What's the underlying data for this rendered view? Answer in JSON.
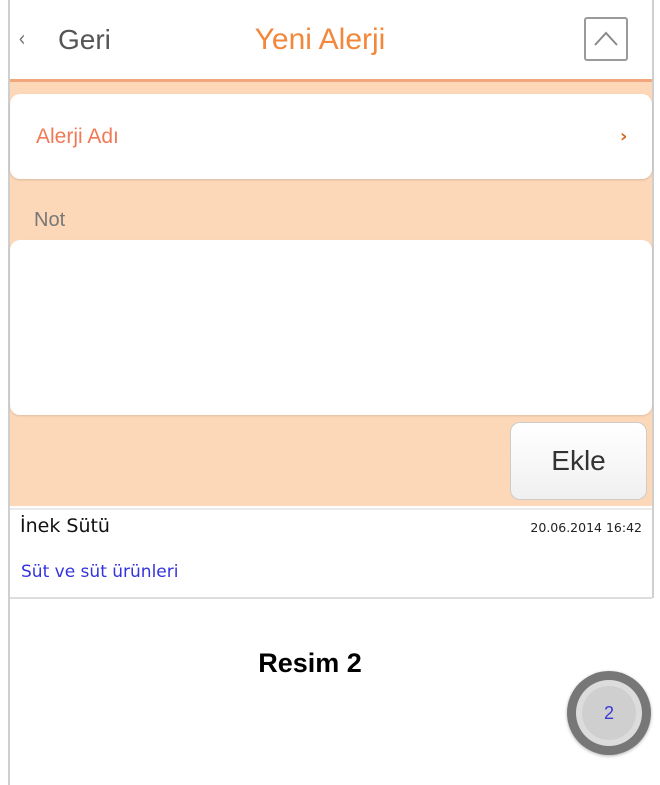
{
  "header": {
    "back_label": "Geri",
    "title": "Yeni Alerji",
    "back_icon": "chevron-left-icon",
    "collapse_icon": "chevron-up-icon"
  },
  "form": {
    "allergy_name_label": "Alerji Adı",
    "note_label": "Not",
    "note_value": "",
    "add_button_label": "Ekle"
  },
  "list": {
    "items": [
      {
        "name": "İnek Sütü",
        "date": "20.06.2014 16:42",
        "category": "Süt ve süt ürünleri"
      }
    ]
  },
  "caption": "Resim 2",
  "page_badge": "2",
  "colors": {
    "accent": "#f1883c",
    "section_background": "#fcd8b8",
    "label_accent": "#f07a55",
    "category_text": "#3333dd"
  }
}
